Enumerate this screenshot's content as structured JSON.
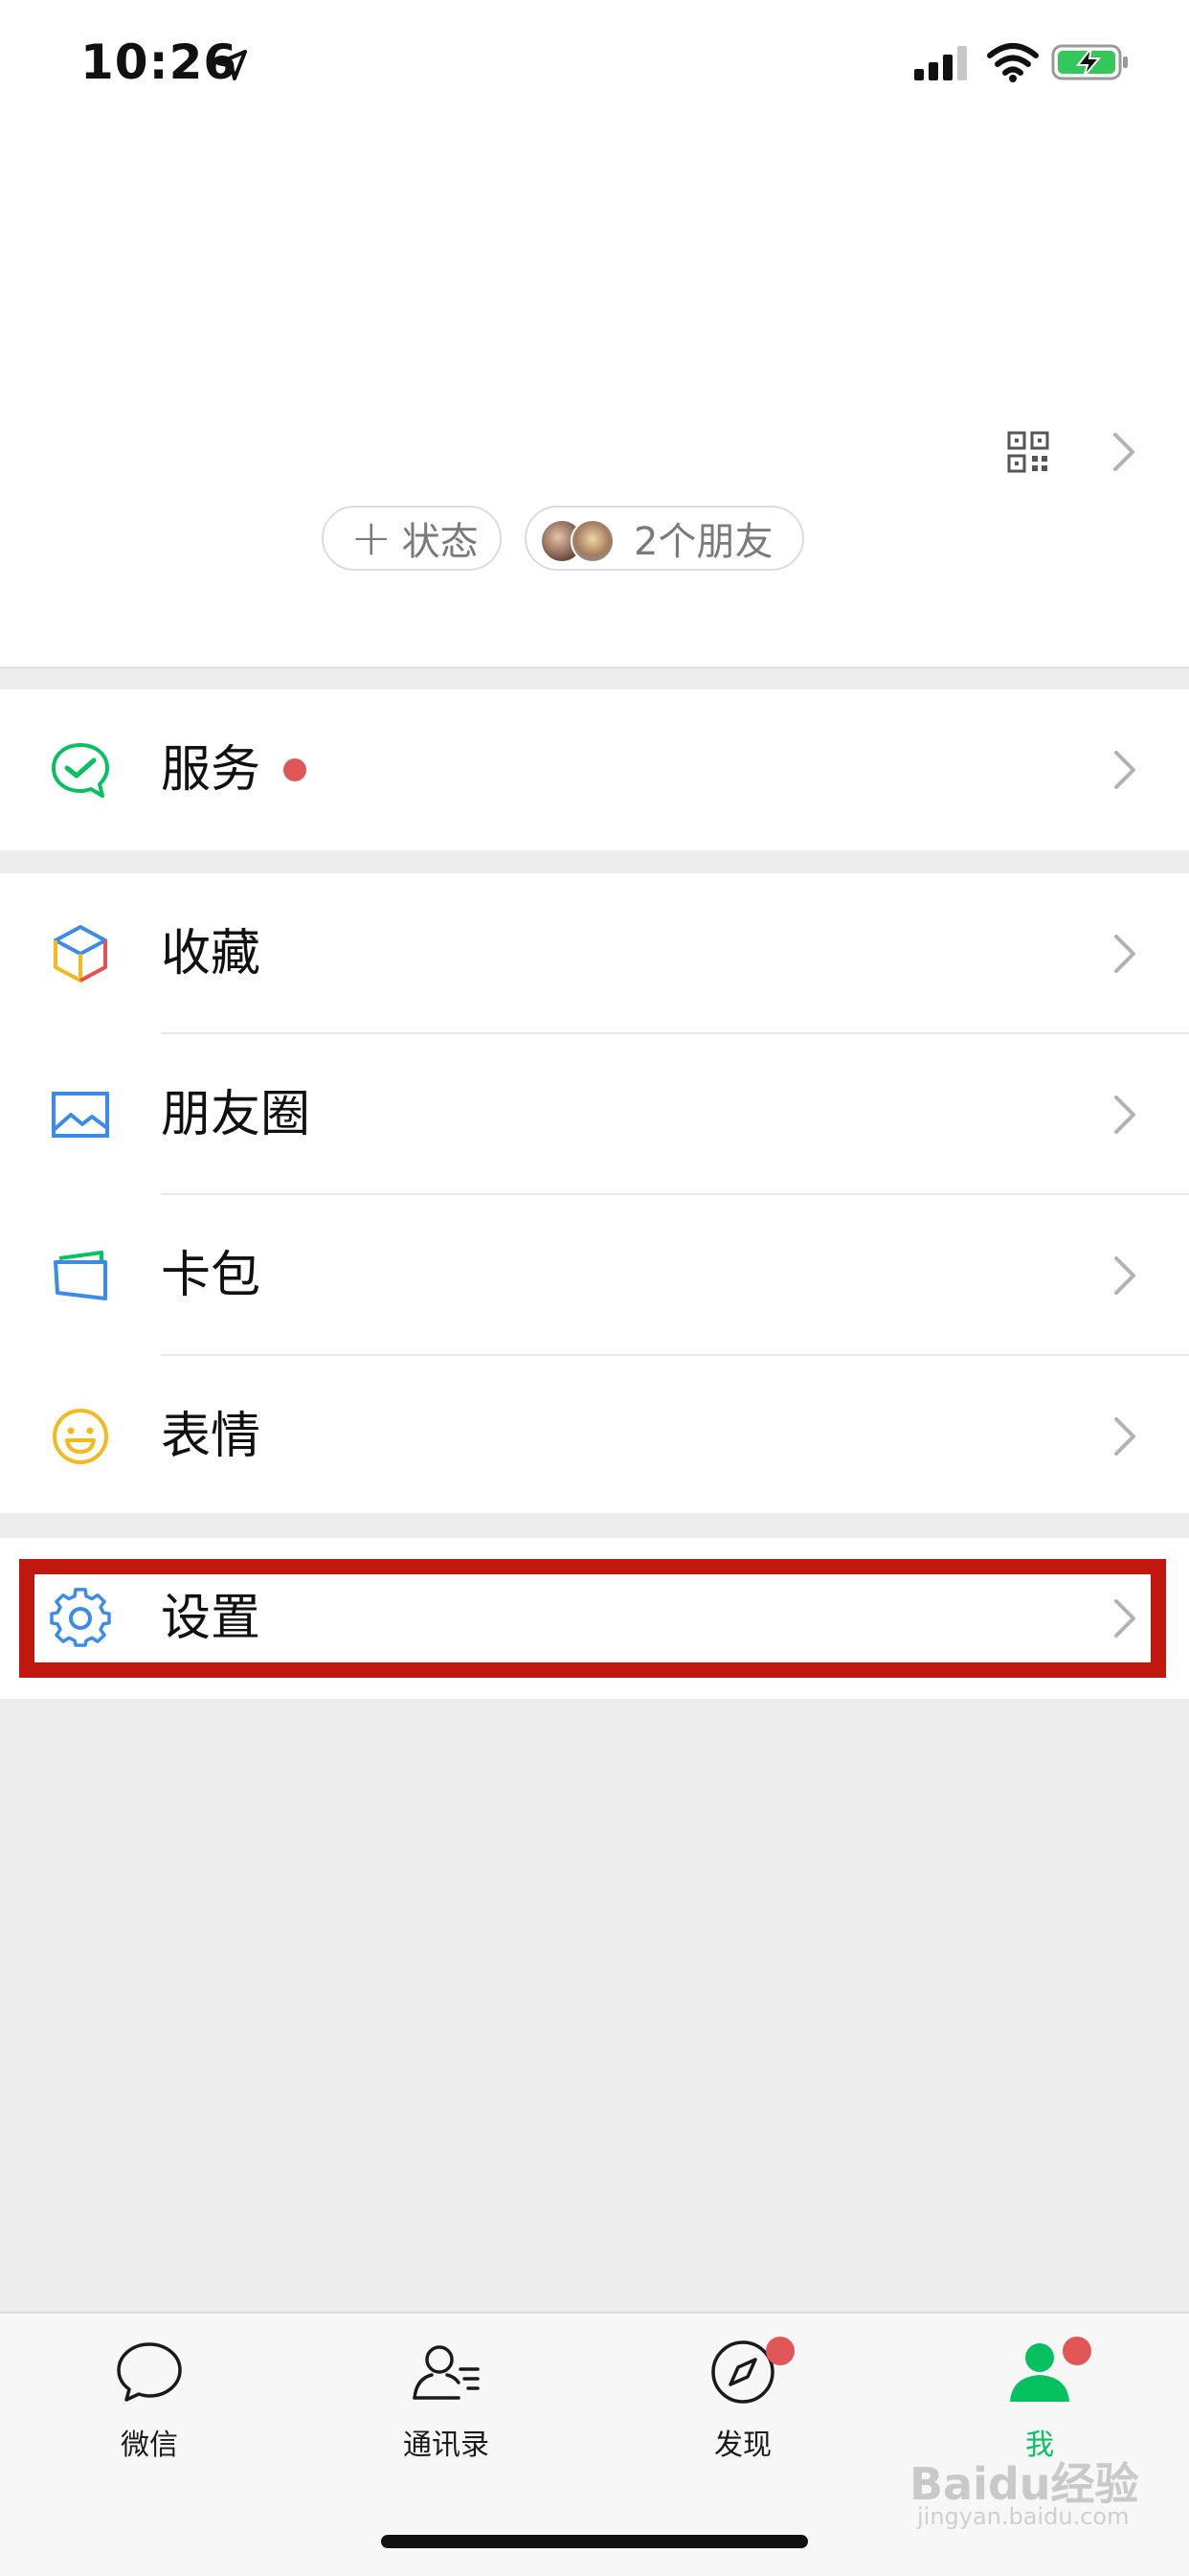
{
  "status_bar": {
    "time": "10:26",
    "icons": [
      "location-arrow-icon",
      "cellular-signal-icon",
      "wifi-icon",
      "battery-charging-icon"
    ]
  },
  "profile": {
    "status_button": "状态",
    "friends_button": "2个朋友",
    "icons": [
      "qr-code-icon",
      "chevron-right-icon"
    ]
  },
  "menu": {
    "services": {
      "label": "服务",
      "has_badge": true
    },
    "favorites": {
      "label": "收藏"
    },
    "moments": {
      "label": "朋友圈"
    },
    "cards": {
      "label": "卡包"
    },
    "stickers": {
      "label": "表情"
    },
    "settings": {
      "label": "设置"
    }
  },
  "tabbar": {
    "tabs": [
      {
        "label": "微信",
        "icon": "chat-bubble-icon",
        "active": false,
        "badge": false
      },
      {
        "label": "通讯录",
        "icon": "contacts-icon",
        "active": false,
        "badge": false
      },
      {
        "label": "发现",
        "icon": "compass-icon",
        "active": false,
        "badge": true
      },
      {
        "label": "我",
        "icon": "person-icon",
        "active": true,
        "badge": true
      }
    ]
  },
  "watermark": {
    "main": "Baidu经验",
    "sub": "jingyan.baidu.com"
  },
  "colors": {
    "accent_green": "#07c160",
    "badge_red": "#e15757",
    "highlight_red": "#c0170f",
    "background": "#ededed"
  }
}
